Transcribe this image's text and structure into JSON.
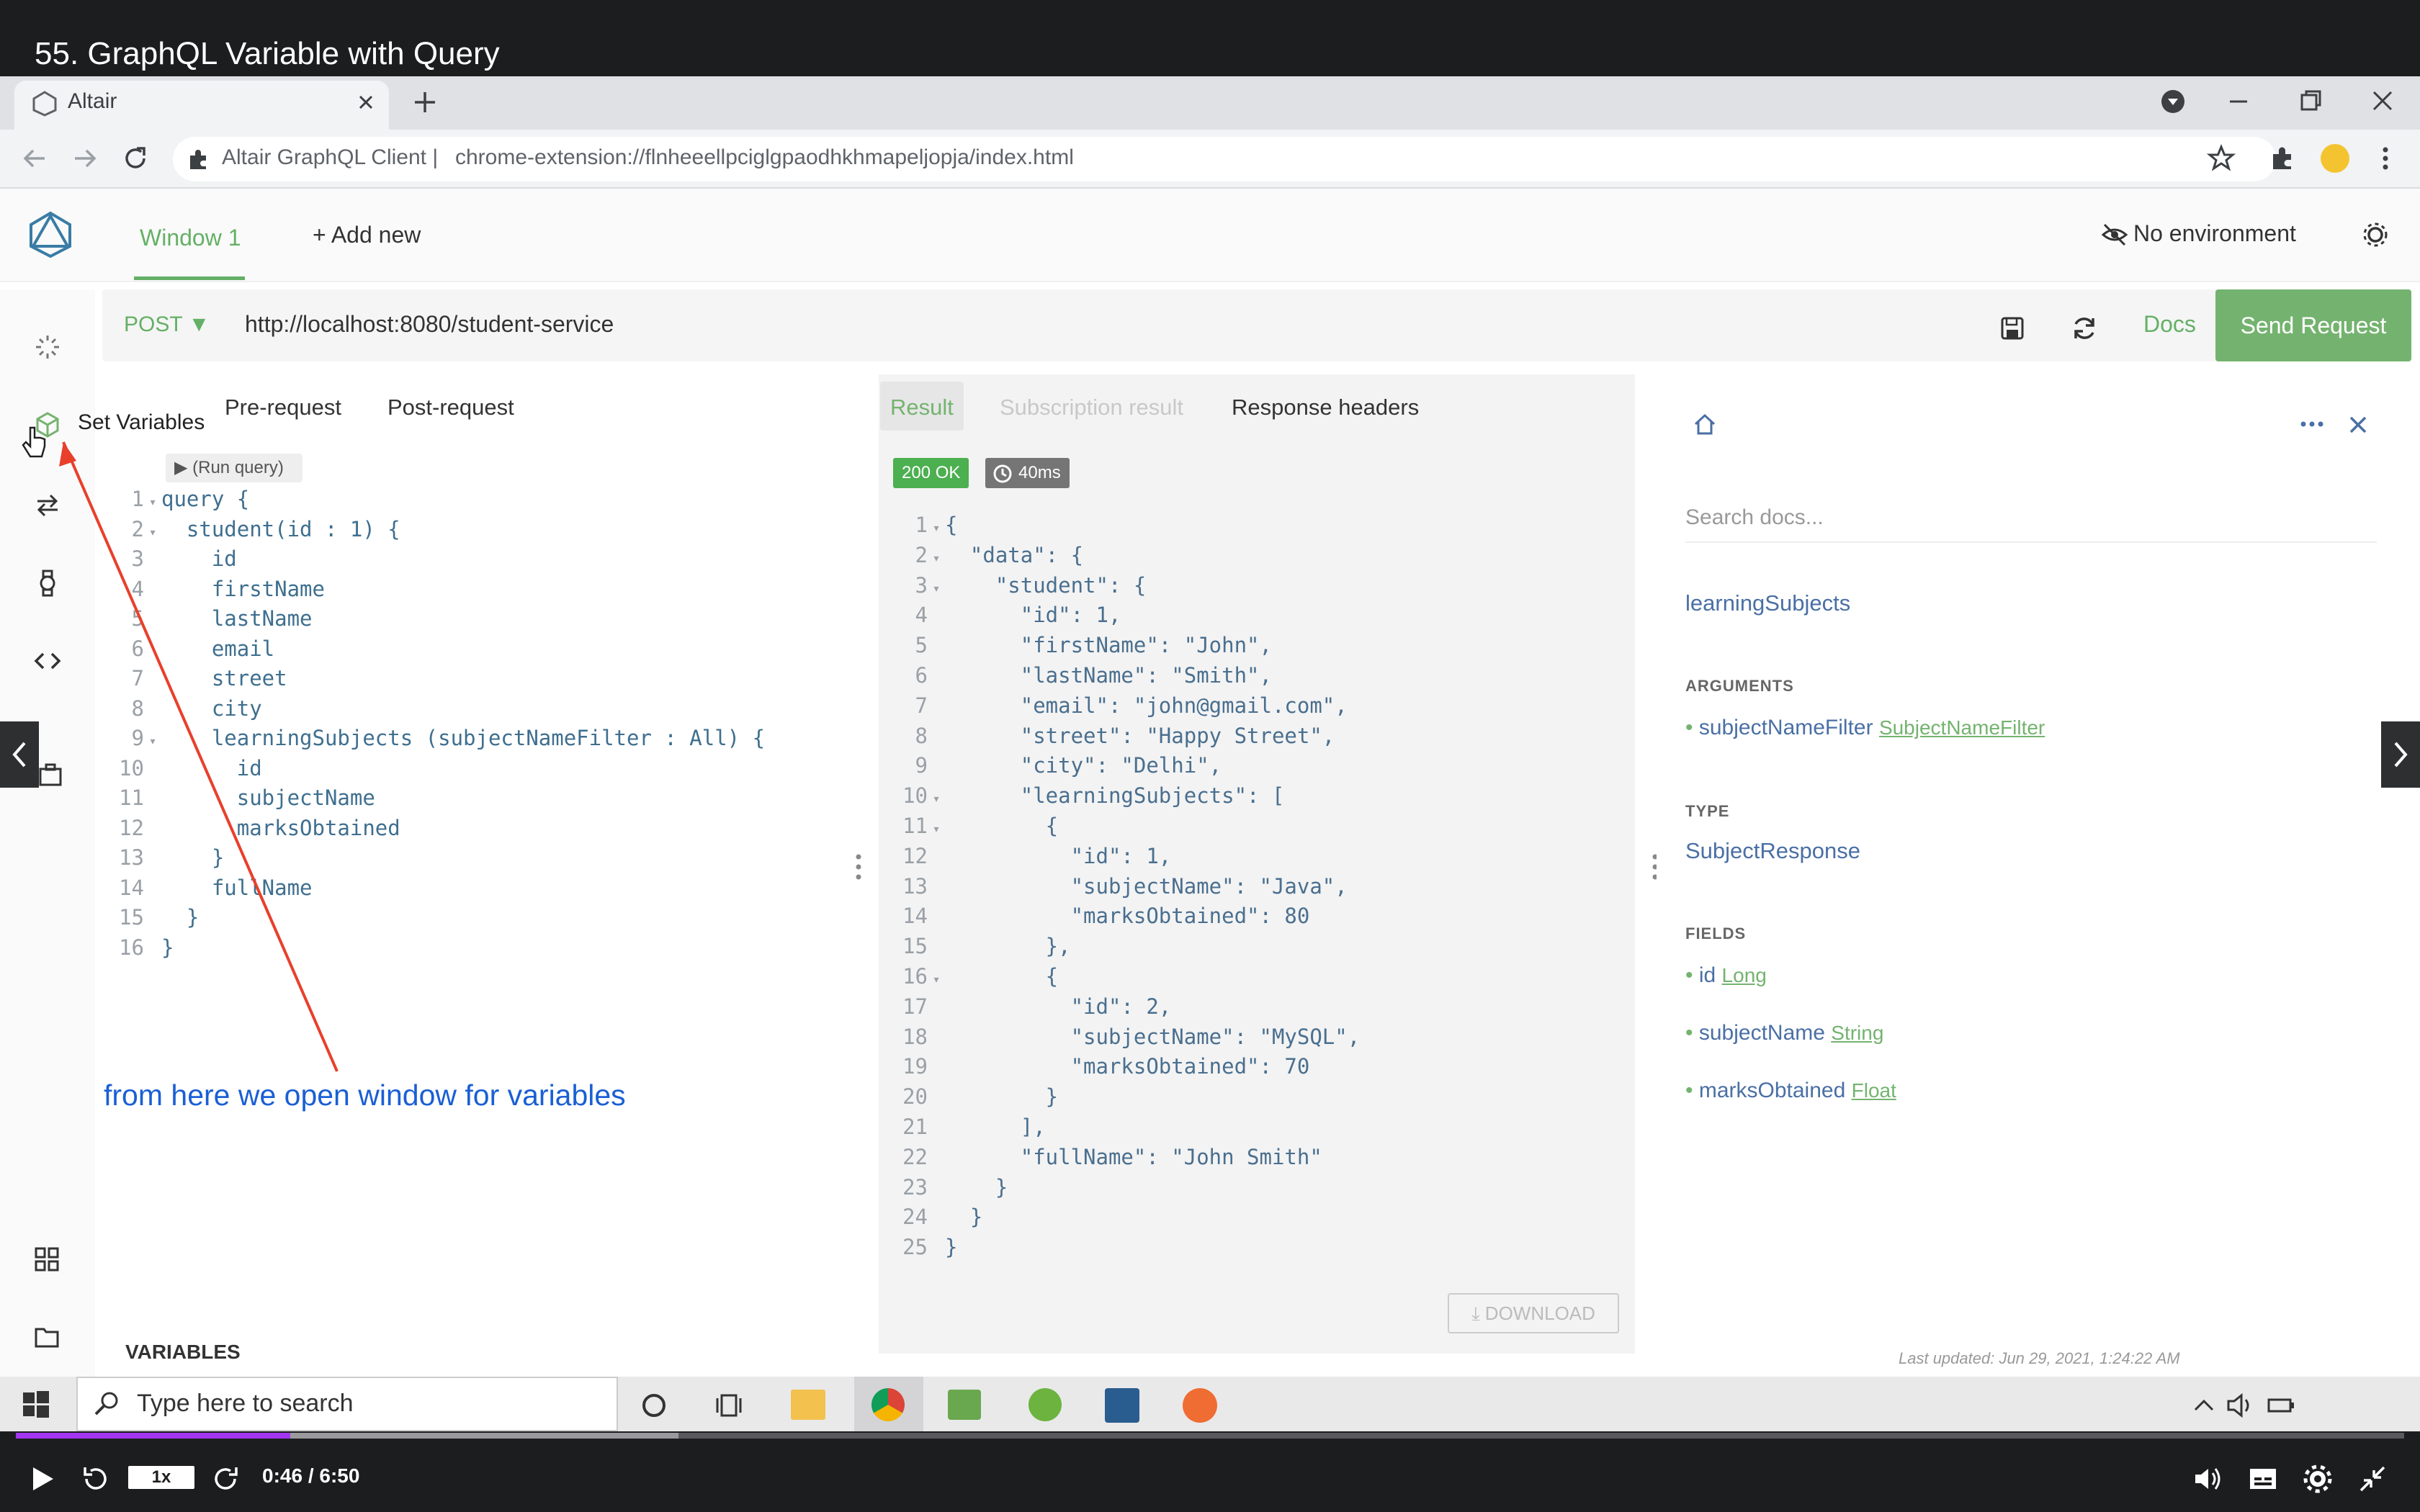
{
  "video": {
    "title": "55. GraphQL Variable with Query",
    "speed": "1x",
    "current_time": "0:46",
    "duration": "6:50",
    "timecode": "0:46 / 6:50",
    "progress_fraction": 0.115
  },
  "browser": {
    "tab_title": "Altair",
    "site_label": "Altair GraphQL Client  |",
    "url": "chrome-extension://flnheeellpciglgpaodhkhmapeljopja/index.html"
  },
  "app": {
    "window_tab": "Window 1",
    "add_new": "+ Add new",
    "environment": "No environment",
    "method": "POST ▼",
    "endpoint": "http://localhost:8080/student-service",
    "docs_label": "Docs",
    "send_label": "Send Request",
    "left_tabs": [
      "Pre-request",
      "Post-request"
    ],
    "sidebar_tooltip": "Set Variables",
    "run_query": "▶ (Run query)",
    "variables_label": "VARIABLES",
    "result_tabs": [
      "Result",
      "Subscription result",
      "Response headers"
    ],
    "status": "200 OK",
    "timing": "40ms",
    "download": "⤓ DOWNLOAD",
    "last_updated": "Last updated: Jun 29, 2021, 1:24:22 AM"
  },
  "query_lines": [
    {
      "n": "1",
      "fold": "▾",
      "text": "query {"
    },
    {
      "n": "2",
      "fold": "▾",
      "text": "  student(id : 1) {"
    },
    {
      "n": "3",
      "fold": "",
      "text": "    id"
    },
    {
      "n": "4",
      "fold": "",
      "text": "    firstName"
    },
    {
      "n": "5",
      "fold": "",
      "text": "    lastName"
    },
    {
      "n": "6",
      "fold": "",
      "text": "    email"
    },
    {
      "n": "7",
      "fold": "",
      "text": "    street"
    },
    {
      "n": "8",
      "fold": "",
      "text": "    city"
    },
    {
      "n": "9",
      "fold": "▾",
      "text": "    learningSubjects (subjectNameFilter : All) {"
    },
    {
      "n": "10",
      "fold": "",
      "text": "      id"
    },
    {
      "n": "11",
      "fold": "",
      "text": "      subjectName"
    },
    {
      "n": "12",
      "fold": "",
      "text": "      marksObtained"
    },
    {
      "n": "13",
      "fold": "",
      "text": "    }"
    },
    {
      "n": "14",
      "fold": "",
      "text": "    fullName"
    },
    {
      "n": "15",
      "fold": "",
      "text": "  }"
    },
    {
      "n": "16",
      "fold": "",
      "text": "}"
    }
  ],
  "result_lines": [
    {
      "n": "1",
      "fold": "▾",
      "text": "{"
    },
    {
      "n": "2",
      "fold": "▾",
      "text": "  \"data\": {"
    },
    {
      "n": "3",
      "fold": "▾",
      "text": "    \"student\": {"
    },
    {
      "n": "4",
      "fold": "",
      "text": "      \"id\": 1,"
    },
    {
      "n": "5",
      "fold": "",
      "text": "      \"firstName\": \"John\","
    },
    {
      "n": "6",
      "fold": "",
      "text": "      \"lastName\": \"Smith\","
    },
    {
      "n": "7",
      "fold": "",
      "text": "      \"email\": \"john@gmail.com\","
    },
    {
      "n": "8",
      "fold": "",
      "text": "      \"street\": \"Happy Street\","
    },
    {
      "n": "9",
      "fold": "",
      "text": "      \"city\": \"Delhi\","
    },
    {
      "n": "10",
      "fold": "▾",
      "text": "      \"learningSubjects\": ["
    },
    {
      "n": "11",
      "fold": "▾",
      "text": "        {"
    },
    {
      "n": "12",
      "fold": "",
      "text": "          \"id\": 1,"
    },
    {
      "n": "13",
      "fold": "",
      "text": "          \"subjectName\": \"Java\","
    },
    {
      "n": "14",
      "fold": "",
      "text": "          \"marksObtained\": 80"
    },
    {
      "n": "15",
      "fold": "",
      "text": "        },"
    },
    {
      "n": "16",
      "fold": "▾",
      "text": "        {"
    },
    {
      "n": "17",
      "fold": "",
      "text": "          \"id\": 2,"
    },
    {
      "n": "18",
      "fold": "",
      "text": "          \"subjectName\": \"MySQL\","
    },
    {
      "n": "19",
      "fold": "",
      "text": "          \"marksObtained\": 70"
    },
    {
      "n": "20",
      "fold": "",
      "text": "        }"
    },
    {
      "n": "21",
      "fold": "",
      "text": "      ],"
    },
    {
      "n": "22",
      "fold": "",
      "text": "      \"fullName\": \"John Smith\""
    },
    {
      "n": "23",
      "fold": "",
      "text": "    }"
    },
    {
      "n": "24",
      "fold": "",
      "text": "  }"
    },
    {
      "n": "25",
      "fold": "",
      "text": "}"
    }
  ],
  "docs": {
    "search_placeholder": "Search docs...",
    "title": "learningSubjects",
    "arguments_head": "ARGUMENTS",
    "argument": {
      "name": "subjectNameFilter",
      "type": "SubjectNameFilter"
    },
    "type_head": "TYPE",
    "type": "SubjectResponse",
    "fields_head": "FIELDS",
    "fields": [
      {
        "name": "id",
        "type": "Long"
      },
      {
        "name": "subjectName",
        "type": "String"
      },
      {
        "name": "marksObtained",
        "type": "Float"
      }
    ]
  },
  "annotation": "from here we open window for variables",
  "taskbar": {
    "search_text": "Type here to search"
  },
  "colors": {
    "accent_green": "#74b36f",
    "annotation_arrow": "#e8402b",
    "progress_purple": "#a435f0"
  }
}
